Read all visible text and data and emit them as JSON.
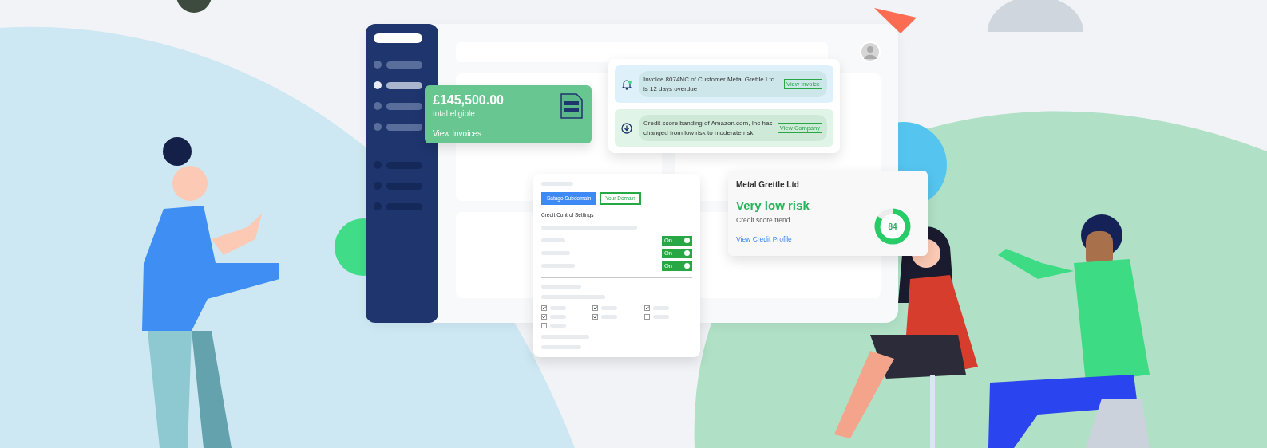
{
  "invoice_card": {
    "amount": "£145,500.00",
    "label": "total eligible",
    "link": "View Invoices"
  },
  "notifications": [
    {
      "kind": "bell",
      "text": "Invoice 8074NC of Customer Metal Grettle Ltd is 12 days overdue",
      "link": "View Invoice"
    },
    {
      "kind": "download",
      "text": "Credit score banding of Amazon.com, Inc has changed from low risk to moderate risk",
      "link": "View Company"
    }
  ],
  "settings": {
    "domain_tabs": [
      {
        "label": "Satago Subdomain",
        "selected": true
      },
      {
        "label": "Your Domain",
        "selected": false
      }
    ],
    "section_title": "Credit Control Settings",
    "toggles": [
      {
        "label": "On",
        "on": true
      },
      {
        "label": "On",
        "on": true
      },
      {
        "label": "On",
        "on": true
      }
    ],
    "checkboxes": [
      {
        "checked": true
      },
      {
        "checked": true
      },
      {
        "checked": true
      },
      {
        "checked": true
      },
      {
        "checked": true
      },
      {
        "checked": false
      },
      {
        "checked": false
      }
    ]
  },
  "risk_card": {
    "company": "Metal Grettle Ltd",
    "rating": "Very low risk",
    "subtitle": "Credit score trend",
    "link": "View Credit Profile",
    "score": "84",
    "level": 0.84
  }
}
